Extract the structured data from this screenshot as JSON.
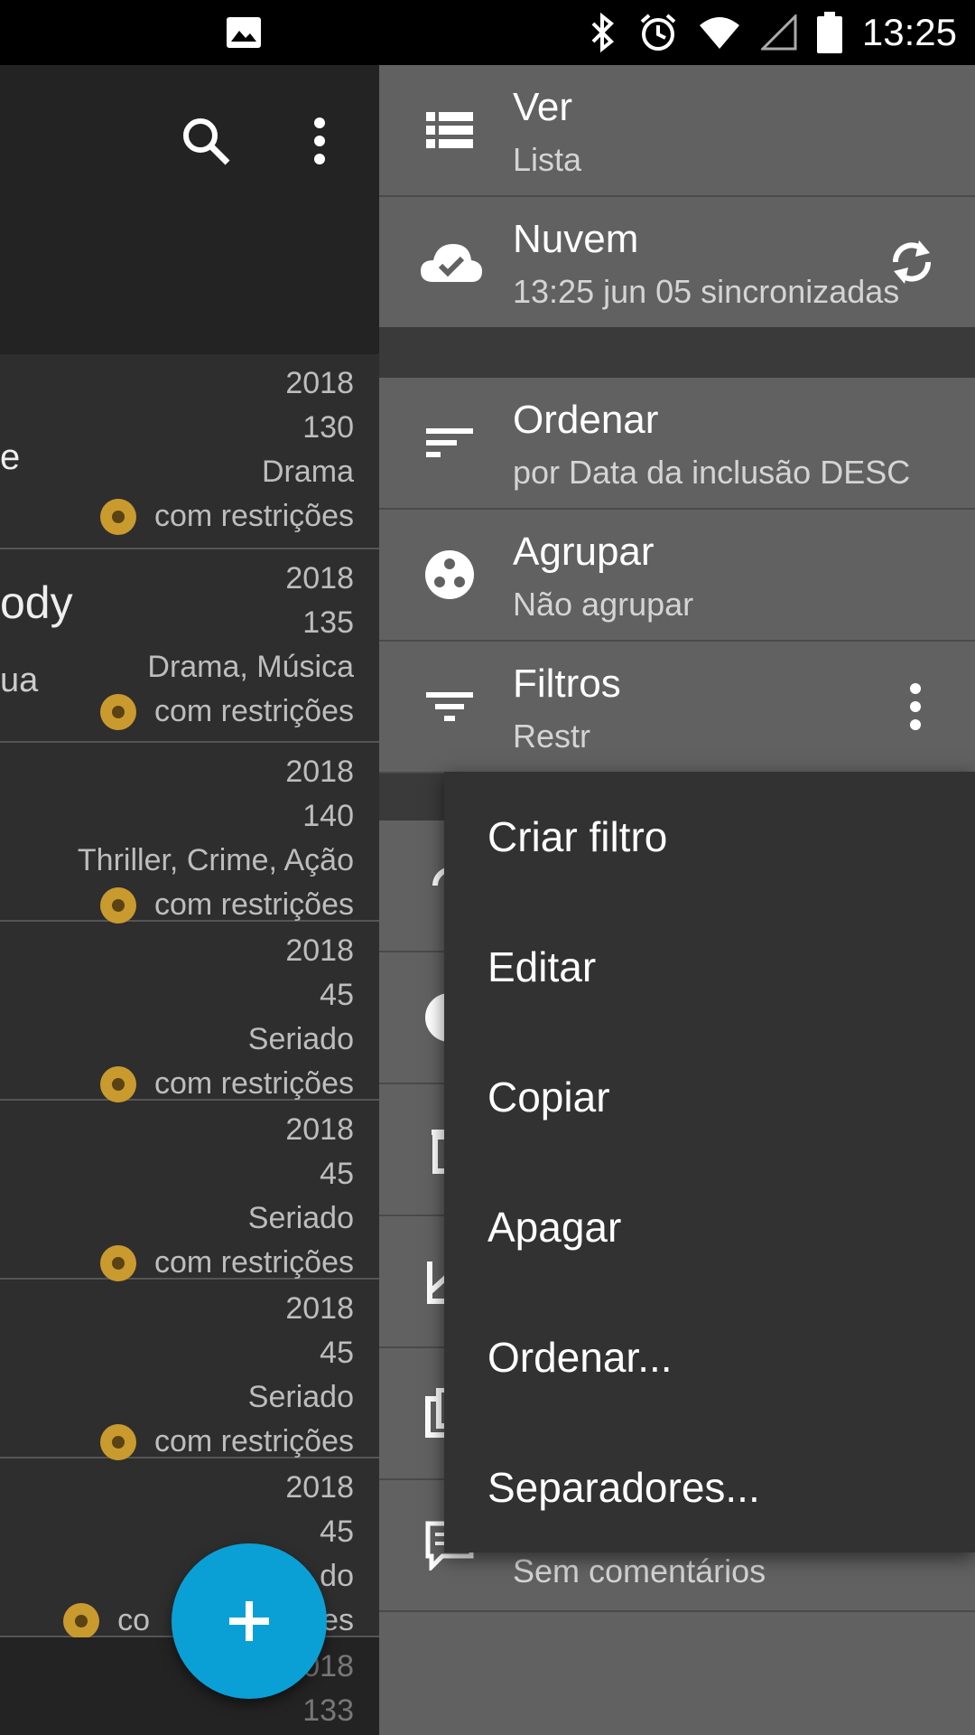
{
  "status_bar": {
    "time": "13:25",
    "icons": [
      "image-icon",
      "bluetooth-icon",
      "alarm-icon",
      "wifi-icon",
      "signal-icon",
      "battery-icon"
    ]
  },
  "toolbar": {
    "icons": [
      "search-icon",
      "more-vert-icon"
    ]
  },
  "list": {
    "partial_texts": [
      "e",
      "ody",
      "ua"
    ],
    "items": [
      {
        "year": "2018",
        "duration": "130",
        "genre": "Drama",
        "rating": "com restrições"
      },
      {
        "year": "2018",
        "duration": "135",
        "genre": "Drama, Música",
        "rating": "com restrições"
      },
      {
        "year": "2018",
        "duration": "140",
        "genre": "Thriller, Crime, Ação",
        "rating": "com restrições"
      },
      {
        "year": "2018",
        "duration": "45",
        "genre": "Seriado",
        "rating": "com restrições"
      },
      {
        "year": "2018",
        "duration": "45",
        "genre": "Seriado",
        "rating": "com restrições"
      },
      {
        "year": "2018",
        "duration": "45",
        "genre": "Seriado",
        "rating": "com restrições"
      },
      {
        "year": "2018",
        "duration": "45",
        "genre": "do",
        "rating": "es"
      }
    ],
    "last_partial": {
      "year": "2018",
      "duration": "133"
    },
    "rating_prefix_partial": "co"
  },
  "drawer": {
    "view": {
      "title": "Ver",
      "subtitle": "Lista"
    },
    "cloud": {
      "title": "Nuvem",
      "subtitle": "13:25 jun 05 sincronizadas"
    },
    "sort": {
      "title": "Ordenar",
      "subtitle": "por Data da inclusão DESC"
    },
    "group": {
      "title": "Agrupar",
      "subtitle": "Não agrupar"
    },
    "filters": {
      "title": "Filtros",
      "subtitle": "Restr"
    },
    "comments": {
      "subtitle": "Sem comentários"
    }
  },
  "popup_menu": {
    "items": [
      "Criar filtro",
      "Editar",
      "Copiar",
      "Apagar",
      "Ordenar...",
      "Separadores..."
    ]
  },
  "fab": {
    "label": "+",
    "color": "#0aa0d6"
  }
}
